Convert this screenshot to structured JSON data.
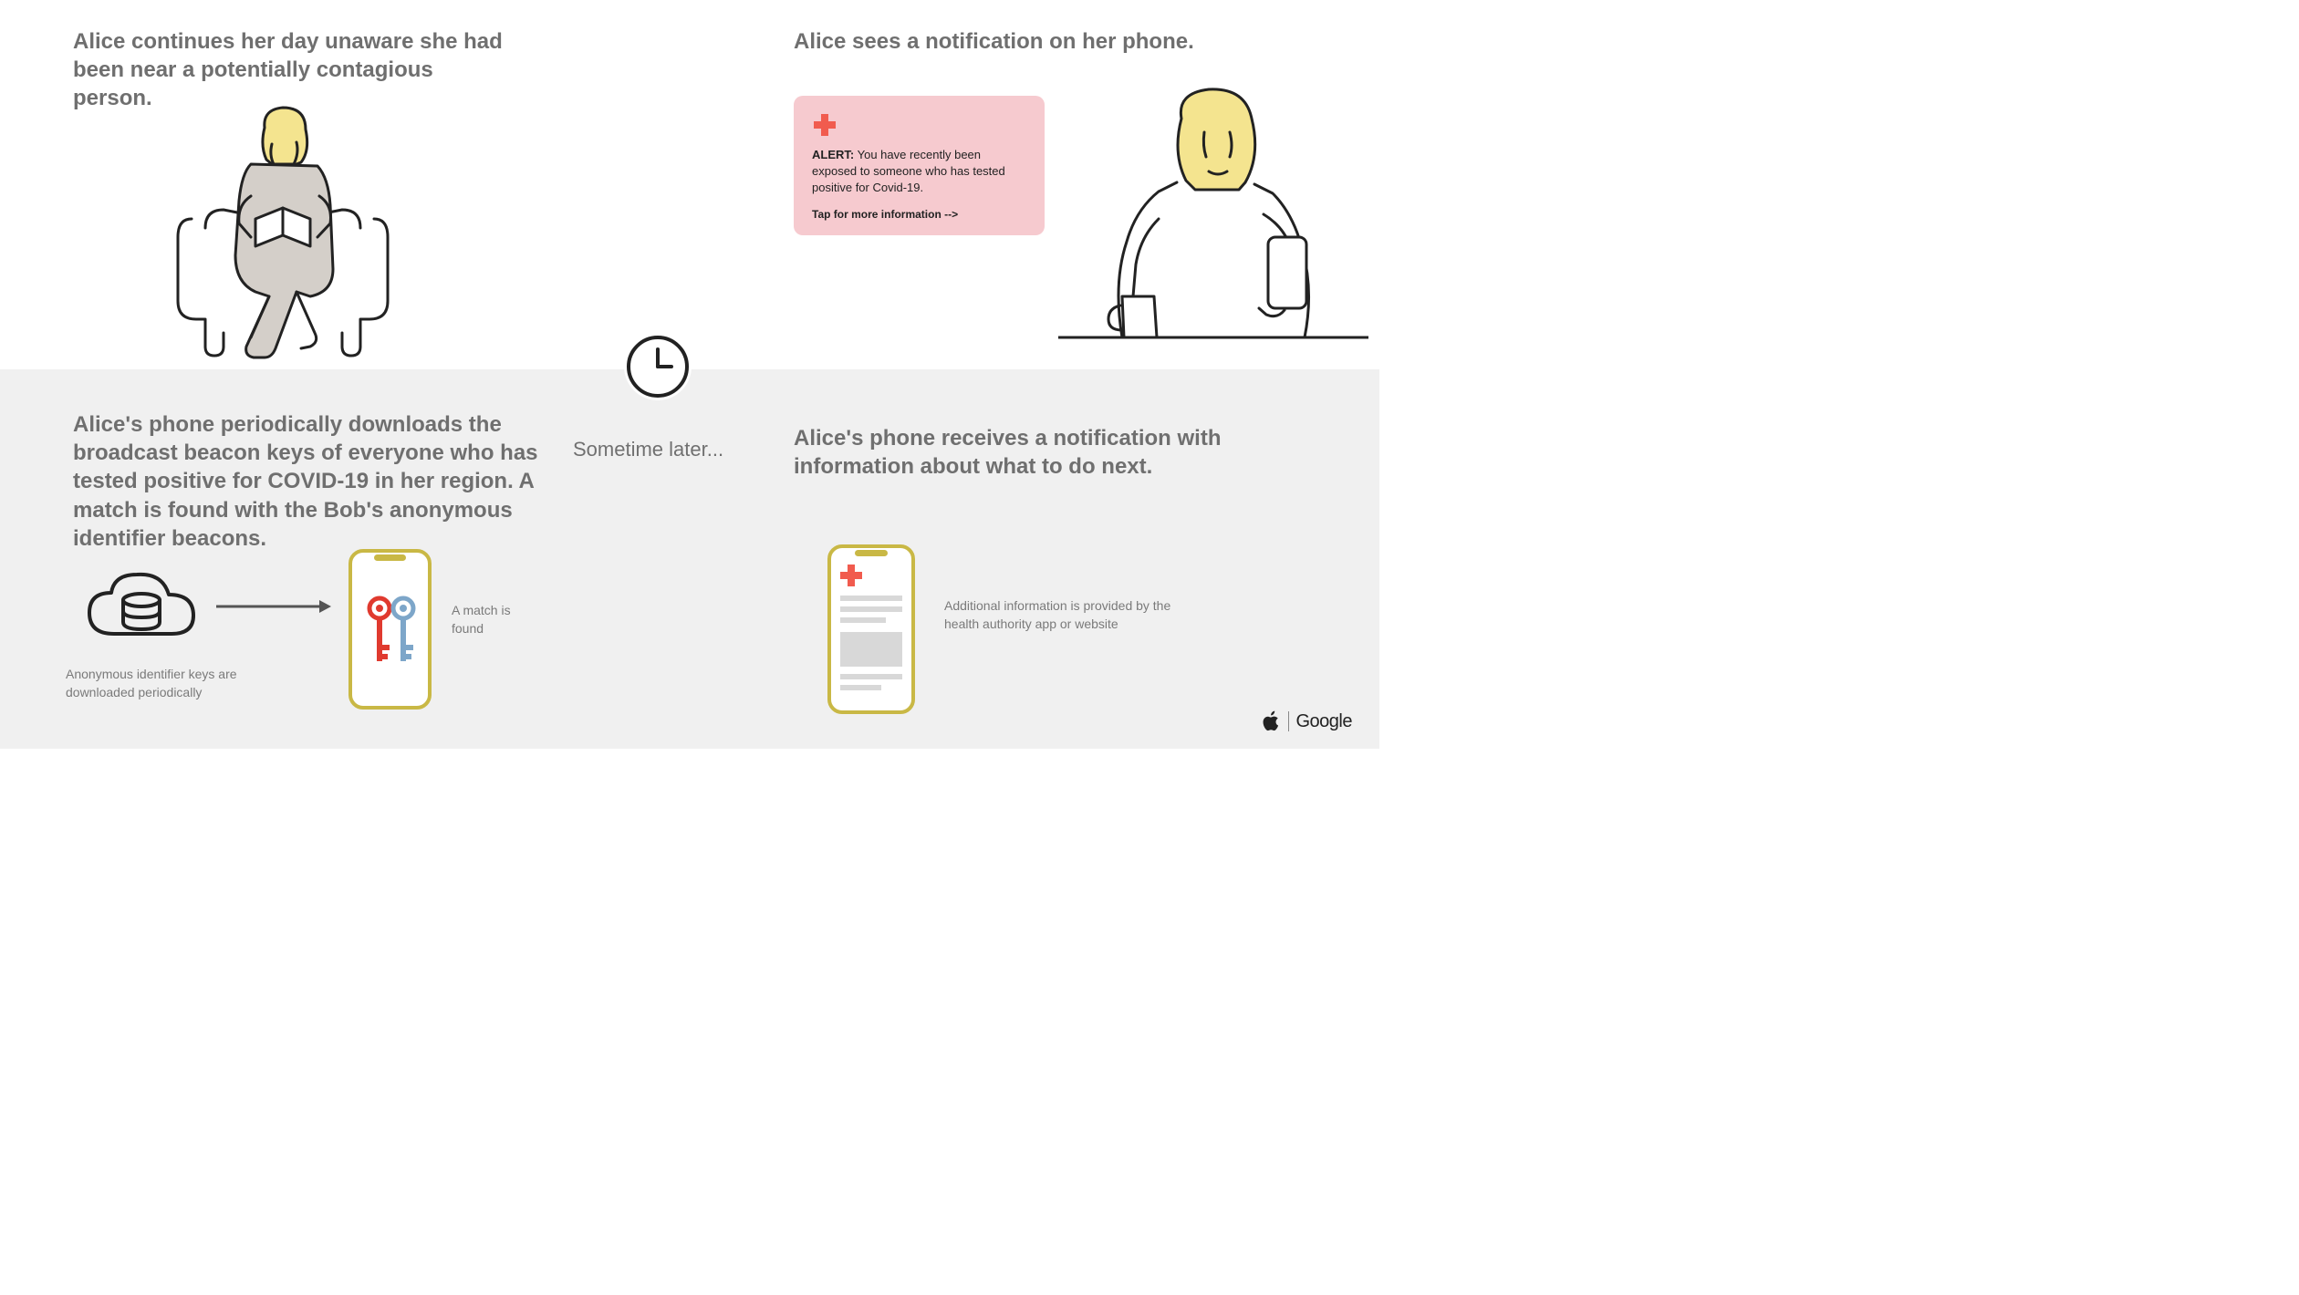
{
  "panels": {
    "top_left": {
      "heading": "Alice continues her day unaware she had been near a potentially contagious person."
    },
    "top_right": {
      "heading": "Alice sees a notification on her phone.",
      "alert_line": "ALERT:  You have recently been exposed to someone who has tested positive for Covid-19.",
      "alert_tap": "Tap for more information -->"
    },
    "bottom_left": {
      "heading": "Alice's phone periodically downloads the broadcast beacon keys of everyone who has tested positive for COVID-19 in her region. A match is found with the Bob's anonymous identifier beacons.",
      "caption_cloud": "Anonymous identifier keys are downloaded periodically",
      "caption_match": "A match is found"
    },
    "bottom_right": {
      "heading": "Alice's phone receives a notification with information about what to do next.",
      "caption_info": "Additional information is provided by the health authority app or website"
    }
  },
  "center_label": "Sometime later...",
  "footer": {
    "apple": "Apple",
    "google": "Google"
  }
}
